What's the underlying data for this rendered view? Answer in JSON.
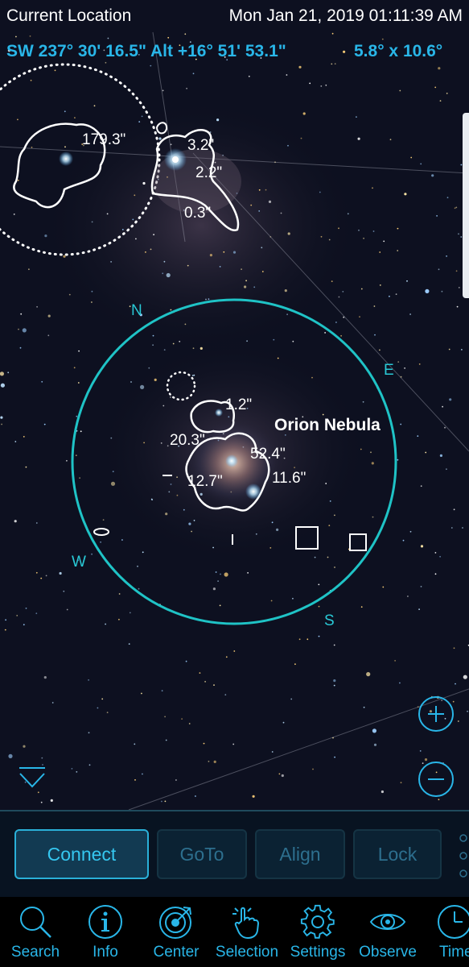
{
  "status_bar": {
    "location": "Current Location",
    "datetime": "Mon Jan 21, 2019  01:11:39 AM"
  },
  "coords": {
    "direction": "SW 237° 30' 16.5\" Alt +16° 51' 53.1\"",
    "fov": "5.8° x 10.6°"
  },
  "sky": {
    "object_name": "Orion Nebula",
    "size_labels": [
      "179.3\"",
      "3.2\"",
      "2.2\"",
      "0.3\"",
      "1.2\"",
      "20.3\"",
      "52.4\"",
      "12.7\"",
      "11.6\""
    ],
    "cardinals": {
      "north": "N",
      "east": "E",
      "south": "S",
      "west": "W"
    }
  },
  "zoom": {
    "in_icon": "plus-icon",
    "out_icon": "minus-icon"
  },
  "panel": {
    "connect": "Connect",
    "goto": "GoTo",
    "align": "Align",
    "lock": "Lock"
  },
  "tabs": [
    {
      "label": "Search",
      "icon": "magnifier-icon"
    },
    {
      "label": "Info",
      "icon": "info-icon"
    },
    {
      "label": "Center",
      "icon": "target-icon"
    },
    {
      "label": "Selection",
      "icon": "hand-pointer-icon"
    },
    {
      "label": "Settings",
      "icon": "gear-icon"
    },
    {
      "label": "Observe",
      "icon": "eye-icon"
    },
    {
      "label": "Time",
      "icon": "clock-icon"
    }
  ],
  "colors": {
    "accent": "#29b6e8",
    "circle": "#1fc3c6",
    "background": "#0c0f1c"
  }
}
